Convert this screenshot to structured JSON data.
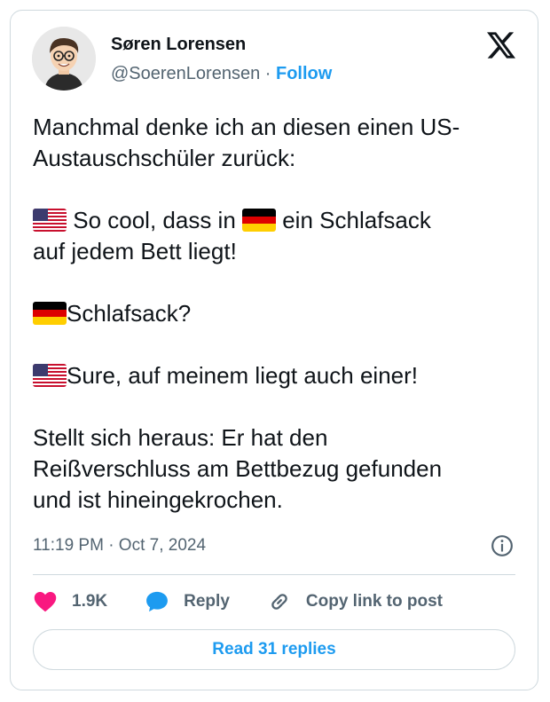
{
  "author": {
    "name": "Søren Lorensen",
    "handle": "@SoerenLorensen",
    "separator": "·",
    "follow_label": "Follow",
    "avatar_icon": "avatar-cartoon-man-with-glasses"
  },
  "platform_icon": "x-logo-icon",
  "tweet": {
    "line1": "Manchmal denke ich an diesen einen US-",
    "line2": "Austauschschüler zurück:",
    "p2_a": " So cool, dass in ",
    "p2_b": " ein Schlafsack",
    "p2_c": "auf jedem Bett liegt!",
    "p3": "Schlafsack?",
    "p4": "Sure, auf meinem liegt auch einer!",
    "p5_l1": "Stellt sich heraus: Er hat den",
    "p5_l2": "Reißverschluss am Bettbezug gefunden",
    "p5_l3": "und ist hineingekrochen."
  },
  "meta": {
    "timestamp": "11:19 PM · Oct 7, 2024"
  },
  "actions": {
    "likes": "1.9K",
    "reply_label": "Reply",
    "copy_label": "Copy link to post"
  },
  "read_replies_label": "Read 31 replies",
  "colors": {
    "accent": "#1d9bf0",
    "like": "#f91880",
    "muted": "#536471",
    "border": "#cfd9de"
  }
}
